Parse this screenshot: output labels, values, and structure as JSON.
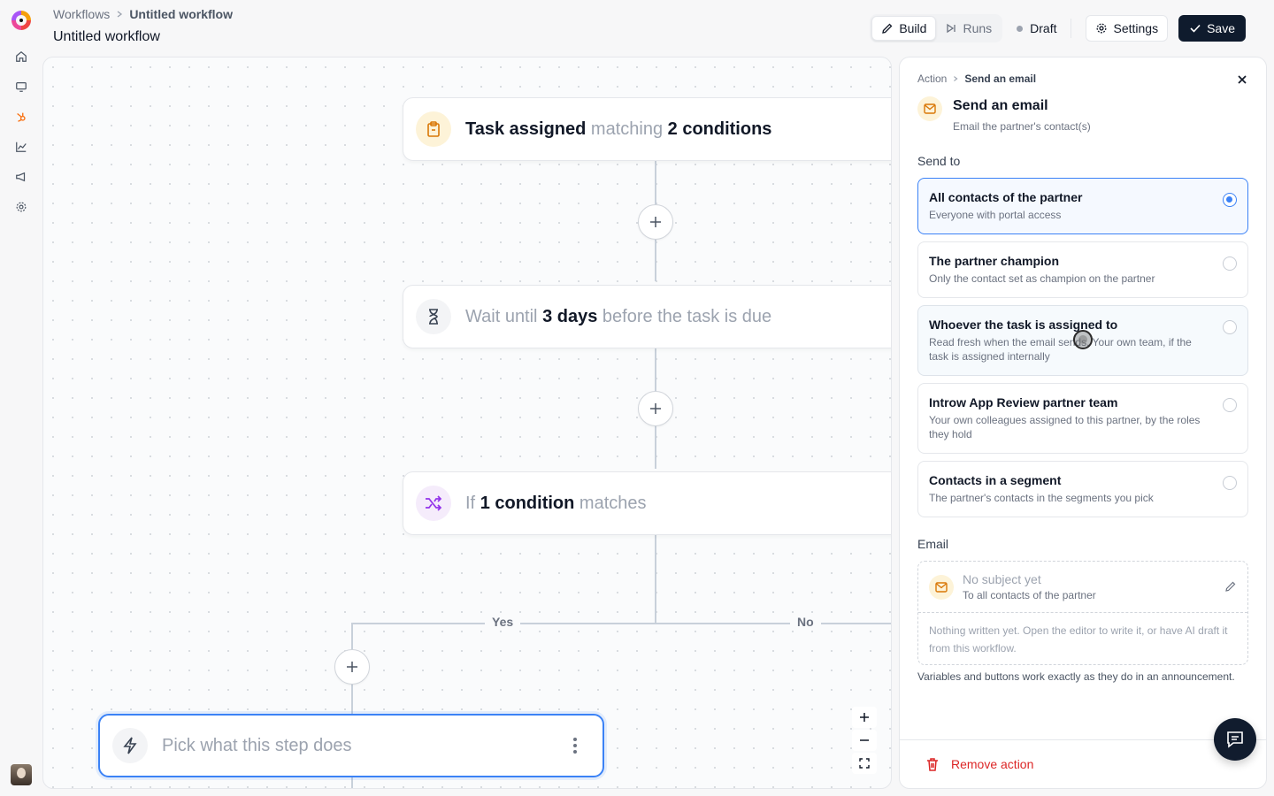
{
  "header": {
    "breadcrumb": [
      "Workflows",
      "Untitled workflow"
    ],
    "title": "Untitled workflow",
    "tabs": [
      {
        "label": "Build",
        "icon": "pencil-icon",
        "active": true
      },
      {
        "label": "Runs",
        "icon": "skip-forward-icon",
        "active": false
      }
    ],
    "status": "Draft",
    "settings_label": "Settings",
    "save_label": "Save"
  },
  "rail": {
    "icons": [
      "home-icon",
      "monitor-icon",
      "hubspot-icon",
      "chart-icon",
      "megaphone-icon",
      "gear-icon"
    ],
    "accent": "#f97316"
  },
  "canvas": {
    "trigger": {
      "pre": "Task assigned",
      "mid": "matching",
      "post": "2 conditions",
      "icon": "clipboard-icon"
    },
    "wait": {
      "pre": "Wait until",
      "mid": "3 days",
      "post": "before the task is due",
      "icon": "hourglass-icon"
    },
    "branch": {
      "pre": "If",
      "mid": "1 condition",
      "post": "matches",
      "icon": "shuffle-icon"
    },
    "yes_label": "Yes",
    "no_label": "No",
    "empty_step": "Pick what this step does"
  },
  "panel": {
    "breadcrumb": [
      "Action",
      "Send an email"
    ],
    "title": "Send an email",
    "subtitle": "Email the partner's contact(s)",
    "send_to_label": "Send to",
    "options": [
      {
        "title": "All contacts of the partner",
        "desc": "Everyone with portal access",
        "selected": true
      },
      {
        "title": "The partner champion",
        "desc": "Only the contact set as champion on the partner",
        "selected": false
      },
      {
        "title": "Whoever the task is assigned to",
        "desc": "Read fresh when the email sends. Your own team, if the task is assigned internally",
        "selected": false
      },
      {
        "title": "Introw App Review partner team",
        "desc": "Your own colleagues assigned to this partner, by the roles they hold",
        "selected": false
      },
      {
        "title": "Contacts in a segment",
        "desc": "The partner's contacts in the segments you pick",
        "selected": false
      }
    ],
    "email_label": "Email",
    "email": {
      "subject_placeholder": "No subject yet",
      "to": "To all contacts of the partner",
      "body_placeholder": "Nothing written yet. Open the editor to write it, or have AI draft it from this workflow."
    },
    "note": "Variables and buttons work exactly as they do in an announcement.",
    "remove_label": "Remove action",
    "accent": "#3b82f6",
    "danger": "#dc2626"
  }
}
